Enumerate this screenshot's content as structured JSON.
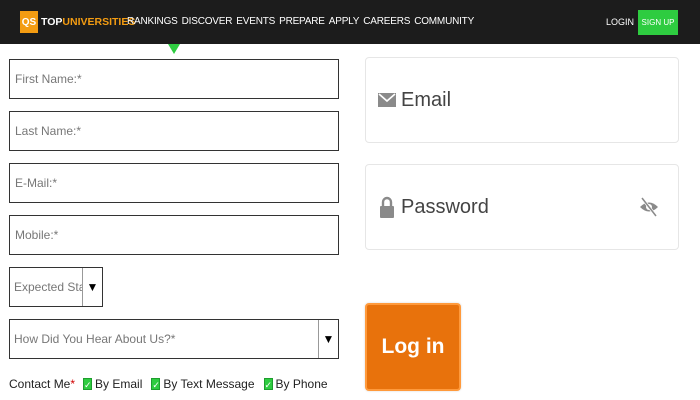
{
  "header": {
    "logo_mark": "QS",
    "logo_top": "TOP",
    "logo_universities": "UNIVERSITIES",
    "nav_items": [
      "RANKINGS",
      "DISCOVER",
      "EVENTS",
      "PREPARE",
      "APPLY",
      "CAREERS",
      "COMMUNITY"
    ],
    "login_label": "LOGIN",
    "signup_label": "SIGN UP"
  },
  "form": {
    "first_name_placeholder": "First Name:*",
    "last_name_placeholder": "Last Name:*",
    "email_placeholder": "E-Mail:*",
    "mobile_placeholder": "Mobile:*",
    "start_year_value": "Expected Start Y",
    "hear_about_value": "How Did You Hear About Us?*",
    "contact_label": "Contact Me",
    "contact_required": "*",
    "contact_options": [
      {
        "label": "By Email",
        "checked": true
      },
      {
        "label": "By Text Message",
        "checked": true
      },
      {
        "label": "By Phone",
        "checked": true
      }
    ]
  },
  "login_panel": {
    "email_label": "Email",
    "password_label": "Password",
    "login_button_label": "Log in"
  },
  "colors": {
    "topbar": "#1c1c1c",
    "brand_orange": "#f39c12",
    "signup_green": "#2ecc40",
    "login_button": "#e8720c"
  },
  "icons": [
    "email-icon",
    "lock-icon",
    "eye-off-icon",
    "dropdown-arrow-icon",
    "checkbox-icon"
  ]
}
